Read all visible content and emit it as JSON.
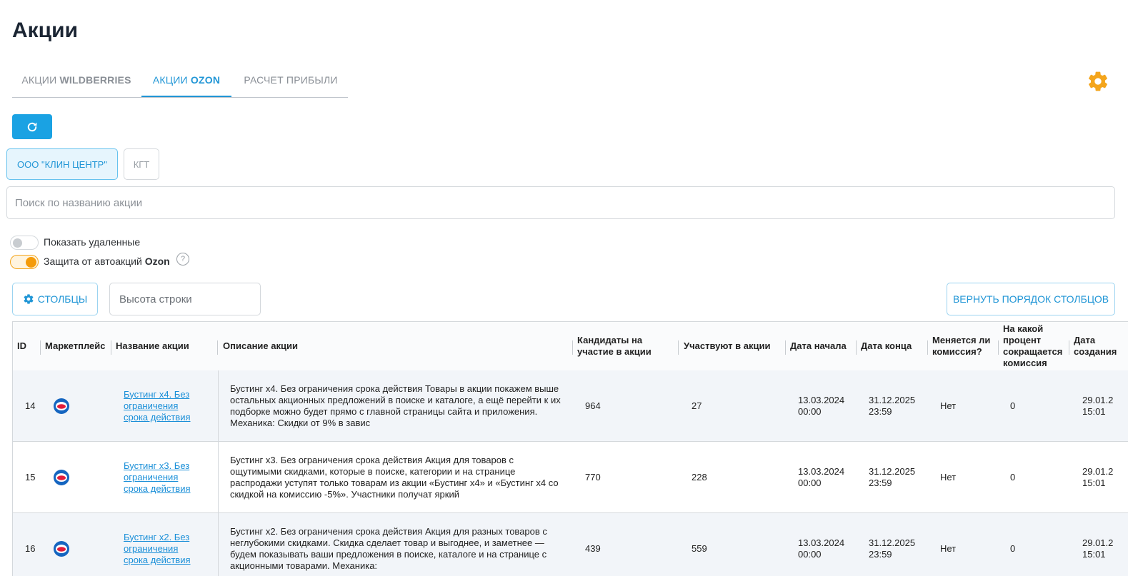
{
  "page": {
    "title": "Акции"
  },
  "tabs": [
    {
      "prefix": "АКЦИИ ",
      "strong": "WILDBERRIES"
    },
    {
      "prefix": "АКЦИИ ",
      "strong": "OZON"
    },
    {
      "prefix": "РАСЧЕТ ПРИБЫЛИ",
      "strong": ""
    }
  ],
  "colors": {
    "accent": "#2196d6",
    "primary_button": "#1aa2e3",
    "toggle_on": "#f49b0b",
    "gear": "#f4a51c"
  },
  "companies": [
    {
      "label": "ООО \"КЛИН ЦЕНТР\""
    },
    {
      "label": "КГТ"
    }
  ],
  "search": {
    "placeholder": "Поиск по названию акции"
  },
  "toggles": {
    "show_deleted": "Показать удаленные",
    "protection_prefix": "Защита от автоакций ",
    "protection_strong": "Ozon",
    "help": "?"
  },
  "toolbar": {
    "columns_label": "СТОЛБЦЫ",
    "row_height_placeholder": "Высота строки",
    "reset_label": "ВЕРНУТЬ ПОРЯДОК СТОЛБЦОВ"
  },
  "table": {
    "headers": [
      "ID",
      "Маркетплейс",
      "Название акции",
      "Описание акции",
      "Кандидаты на участие в акции",
      "Участвуют в акции",
      "Дата начала",
      "Дата конца",
      "Меняется ли комиссия?",
      "На какой процент сокращается комиссия",
      "Дата создания"
    ],
    "rows": [
      {
        "id": "14",
        "marketplace_icon": "ozon-icon",
        "name": "Бустинг x4. Без ограничения срока действия",
        "description": "Бустинг x4. Без ограничения срока действия Товары в акции покажем выше остальных акционных предложений в поиске и каталоге, а ещё перейти к их подборке можно будет прямо с главной страницы сайта и приложения. Механика: Скидки от 9% в завис",
        "candidates": "964",
        "participants": "27",
        "start": "13.03.2024 00:00",
        "end": "31.12.2025 23:59",
        "commission_changes": "Нет",
        "commission_percent": "0",
        "created": "29.01.2 15:01"
      },
      {
        "id": "15",
        "marketplace_icon": "ozon-icon",
        "name": "Бустинг x3. Без ограничения срока действия",
        "description": "Бустинг x3. Без ограничения срока действия Акция для товаров с ощутимыми скидками, которые в поиске, категории и на странице распродажи уступят только товарам из акции «Бустинг x4» и «Бустинг x4 со скидкой на комиссию -5%». Участники получат яркий",
        "candidates": "770",
        "participants": "228",
        "start": "13.03.2024 00:00",
        "end": "31.12.2025 23:59",
        "commission_changes": "Нет",
        "commission_percent": "0",
        "created": "29.01.2 15:01"
      },
      {
        "id": "16",
        "marketplace_icon": "ozon-icon",
        "name": "Бустинг x2. Без ограничения срока действия",
        "description": "Бустинг x2. Без ограничения срока действия Акция для разных товаров с неглубокими скидками. Скидка сделает товар и выгоднее, и заметнее — будем показывать ваши предложения в поиске, каталоге и на странице с акционными товарами. Механика:",
        "candidates": "439",
        "participants": "559",
        "start": "13.03.2024 00:00",
        "end": "31.12.2025 23:59",
        "commission_changes": "Нет",
        "commission_percent": "0",
        "created": "29.01.2 15:01"
      }
    ]
  }
}
